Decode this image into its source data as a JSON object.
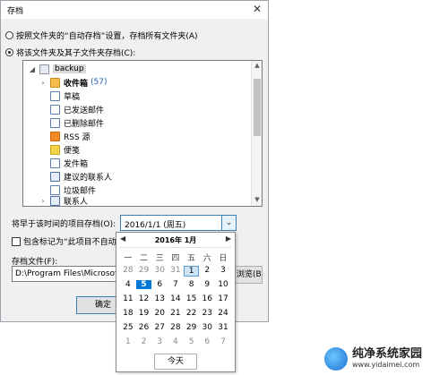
{
  "dialog": {
    "title": "存档"
  },
  "options": {
    "radio1": "按照文件夹的“自动存档”设置，存档所有文件夹(A)",
    "radio2": "将该文件夹及其子文件夹存档(C):"
  },
  "tree": [
    {
      "label": "backup",
      "icon": "root-mailbox-icon",
      "level": 0,
      "expander": "◢",
      "selected": true
    },
    {
      "label": "收件箱",
      "count": "(57)",
      "icon": "inbox-folder-icon",
      "level": 1,
      "expander": "›",
      "bold": true
    },
    {
      "label": "草稿",
      "icon": "drafts-icon",
      "level": 1
    },
    {
      "label": "已发送邮件",
      "icon": "sent-mail-icon",
      "level": 1
    },
    {
      "label": "已删除邮件",
      "icon": "deleted-mail-icon",
      "level": 1
    },
    {
      "label": "RSS 源",
      "icon": "rss-icon",
      "level": 1
    },
    {
      "label": "便笺",
      "icon": "notes-icon",
      "level": 1
    },
    {
      "label": "发件箱",
      "icon": "outbox-icon",
      "level": 1
    },
    {
      "label": "建议的联系人",
      "icon": "contacts-icon",
      "level": 1
    },
    {
      "label": "垃圾邮件",
      "icon": "junk-mail-icon",
      "level": 1
    },
    {
      "label": "联系人",
      "icon": "contacts-icon",
      "level": 1,
      "expander": "›"
    }
  ],
  "archive_before": {
    "label": "将早于该时间的项目存档(O):",
    "value": "2016/1/1 (周五)"
  },
  "include_check": {
    "label": "包含标记为“此项目不自动存档”的项目"
  },
  "archive_file": {
    "label": "存档文件(F):",
    "path": "D:\\Program Files\\Microsoft Office\\archive.pst",
    "browse_label": "浏览(B)..."
  },
  "ok_label": "确定",
  "calendar": {
    "month_label": "2016年 1月",
    "prev": "◀",
    "next": "▶",
    "weekdays": [
      "一",
      "二",
      "三",
      "四",
      "五",
      "六",
      "日"
    ],
    "rows": [
      [
        "28",
        "29",
        "30",
        "31",
        "1",
        "2",
        "3"
      ],
      [
        "4",
        "5",
        "6",
        "7",
        "8",
        "9",
        "10"
      ],
      [
        "11",
        "12",
        "13",
        "14",
        "15",
        "16",
        "17"
      ],
      [
        "18",
        "19",
        "20",
        "21",
        "22",
        "23",
        "24"
      ],
      [
        "25",
        "26",
        "27",
        "28",
        "29",
        "30",
        "31"
      ],
      [
        "1",
        "2",
        "3",
        "4",
        "5",
        "6",
        "7"
      ]
    ],
    "today_label": "今天"
  },
  "watermark": {
    "title": "纯净系统家园",
    "url": "www.yidaimei.com"
  }
}
